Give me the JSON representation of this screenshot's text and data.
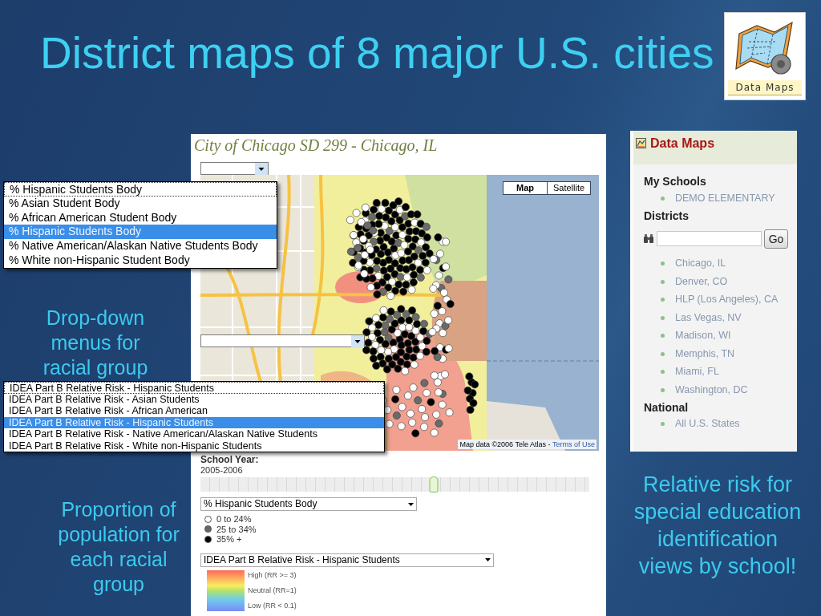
{
  "slide": {
    "title": "District maps of 8 major U.S. cities"
  },
  "logo": {
    "caption": "Data Maps"
  },
  "screenshot": {
    "title": "City of Chicago SD 299 - Chicago, IL",
    "map": {
      "map_types": [
        {
          "label": "Map",
          "selected": true
        },
        {
          "label": "Satellite",
          "selected": false
        }
      ],
      "attribution": "Map data ©2006 Tele Atlas - ",
      "terms_link": "Terms of Use"
    },
    "school_year": {
      "label": "School Year:",
      "value": "2005-2006",
      "level": 0.6
    },
    "population_select": {
      "value": "% Hispanic Students Body"
    },
    "population_legend": [
      {
        "label": "0 to 24%",
        "color": "#ffffff"
      },
      {
        "label": "25 to 34%",
        "color": "#666666"
      },
      {
        "label": "35% +",
        "color": "#000000"
      }
    ],
    "risk_select": {
      "value": "IDEA Part B Relative Risk - Hispanic Students"
    },
    "risk_legend": [
      "High (RR >= 3)",
      "Neutral (RR=1)",
      "Low (RR < 0.1)"
    ]
  },
  "dropdown_lists": [
    {
      "value": "% Hispanic Students Body",
      "options": [
        {
          "label": "% Asian Student Body",
          "selected": false
        },
        {
          "label": "% African American Student Body",
          "selected": false
        },
        {
          "label": "% Hispanic Students Body",
          "selected": true
        },
        {
          "label": "% Native American/Alaskan Native Students Body",
          "selected": false
        },
        {
          "label": "% White non-Hispanic Student Body",
          "selected": false
        }
      ]
    },
    {
      "value": "IDEA Part B Relative Risk - Hispanic Students",
      "options": [
        {
          "label": "IDEA Part B Relative Risk - Asian Students",
          "selected": false
        },
        {
          "label": "IDEA Part B Relative Risk - African American",
          "selected": false
        },
        {
          "label": "IDEA Part B Relative Risk - Hispanic Students",
          "selected": true
        },
        {
          "label": "IDEA Part B Relative Risk - Native American/Alaskan Native Students",
          "selected": false
        },
        {
          "label": "IDEA Part B Relative Risk - White non-Hispanic Students",
          "selected": false
        }
      ]
    }
  ],
  "sidebar": {
    "title": "Data Maps",
    "sections": [
      {
        "heading": "My Schools",
        "links": [
          "DEMO ELEMENTARY"
        ]
      },
      {
        "heading": "Districts",
        "search_button": "Go",
        "links": [
          "Chicago, IL",
          "Denver, CO",
          "HLP (Los Angeles), CA",
          "Las Vegas, NV",
          "Madison, WI",
          "Memphis, TN",
          "Miami, FL",
          "Washington, DC"
        ]
      },
      {
        "heading": "National",
        "links": [
          "All U.S. States"
        ]
      }
    ]
  },
  "captions": {
    "dropdowns": "Drop-down menus for racial group",
    "proportion": "Proportion of population for each racial group",
    "relative_risk": "Relative risk for special education identification views by school!"
  }
}
